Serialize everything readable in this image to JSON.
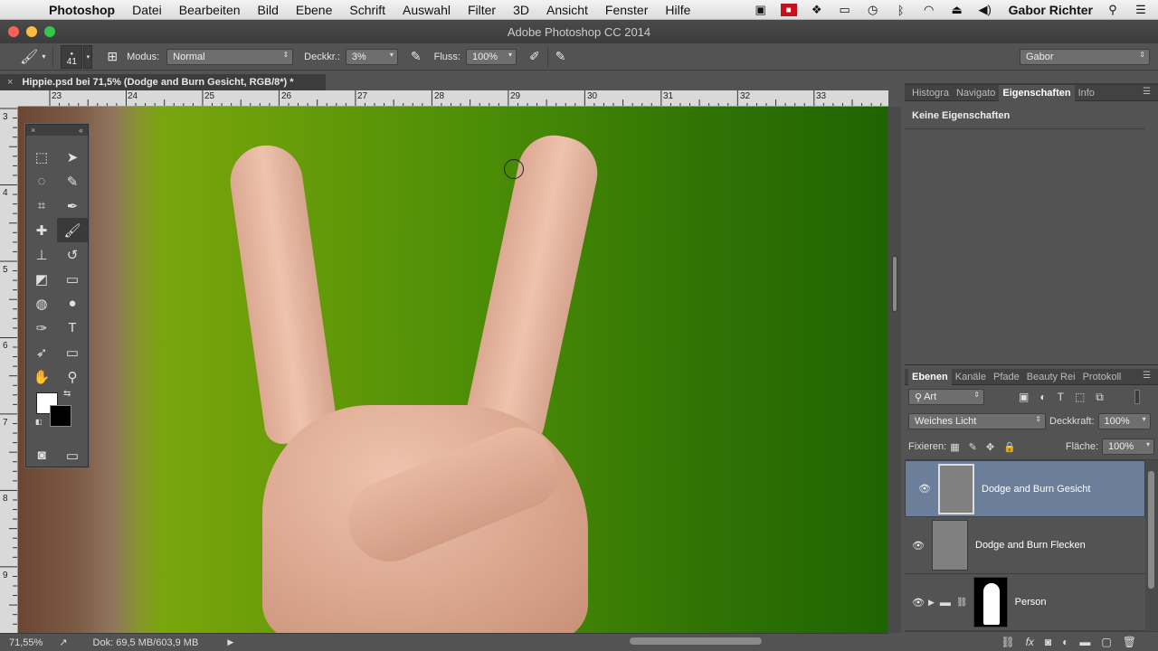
{
  "menubar": {
    "app": "Photoshop",
    "items": [
      "Datei",
      "Bearbeiten",
      "Bild",
      "Ebene",
      "Schrift",
      "Auswahl",
      "Filter",
      "3D",
      "Ansicht",
      "Fenster",
      "Hilfe"
    ],
    "user": "Gabor Richter"
  },
  "window": {
    "title": "Adobe Photoshop CC 2014"
  },
  "options": {
    "brush_size": "41",
    "mode_label": "Modus:",
    "mode_value": "Normal",
    "opacity_label": "Deckkr.:",
    "opacity_value": "3%",
    "flow_label": "Fluss:",
    "flow_value": "100%",
    "preset_value": "Gabor"
  },
  "document": {
    "tab_title": "Hippie.psd bei 71,5% (Dodge and Burn Gesicht, RGB/8*) *",
    "zoom": "71,55%",
    "doc_info": "Dok: 69,5 MB/603,9 MB",
    "ruler_top": [
      "23",
      "24",
      "25",
      "26",
      "27",
      "28",
      "29",
      "30",
      "31",
      "32",
      "33"
    ],
    "ruler_left": [
      "3",
      "4",
      "5",
      "6",
      "7",
      "8",
      "9"
    ]
  },
  "properties_panel": {
    "tabs": [
      "Histogra",
      "Navigato",
      "Eigenschaften",
      "Info"
    ],
    "active_tab": "Eigenschaften",
    "empty_text": "Keine Eigenschaften"
  },
  "layers_panel": {
    "tabs": [
      "Ebenen",
      "Kanäle",
      "Pfade",
      "Beauty Rei",
      "Protokoll"
    ],
    "active_tab": "Ebenen",
    "filter_value": "Art",
    "blend_mode": "Weiches Licht",
    "opacity_label": "Deckkraft:",
    "opacity_value": "100%",
    "lock_label": "Fixieren:",
    "fill_label": "Fläche:",
    "fill_value": "100%",
    "layers": [
      {
        "name": "Dodge and Burn Gesicht",
        "selected": true
      },
      {
        "name": "Dodge and Burn Flecken",
        "selected": false
      },
      {
        "name": "Person",
        "selected": false
      }
    ]
  },
  "colors": {
    "accent_selected_layer": "#6c7f9a",
    "canvas_green": "#4a8c06"
  }
}
